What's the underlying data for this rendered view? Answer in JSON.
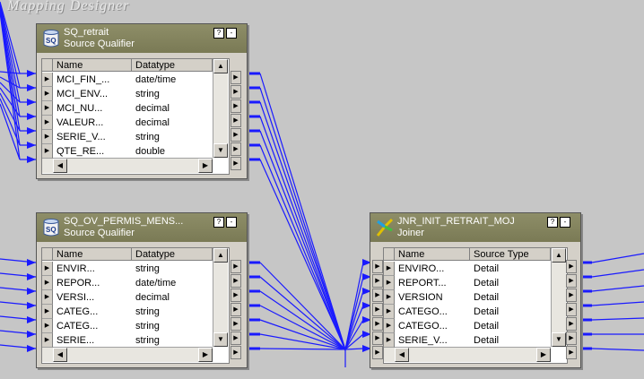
{
  "workspace": {
    "title": "Mapping Designer"
  },
  "colors": {
    "wire": "#1a1aff",
    "header": "#8a8a62"
  },
  "sq_retrait": {
    "name": "SQ_retrait",
    "type": "Source Qualifier",
    "icon": "source-qualifier-icon",
    "help_label": "?",
    "min_label": "-",
    "col1": "Name",
    "col2": "Datatype",
    "rows": [
      {
        "name": "MCI_FIN_...",
        "type": "date/time"
      },
      {
        "name": "MCI_ENV...",
        "type": "string"
      },
      {
        "name": "MCI_NU...",
        "type": "decimal"
      },
      {
        "name": "VALEUR...",
        "type": "decimal"
      },
      {
        "name": "SERIE_V...",
        "type": "string"
      },
      {
        "name": "QTE_RE...",
        "type": "double"
      }
    ]
  },
  "sq_ov": {
    "name": "SQ_OV_PERMIS_MENS...",
    "type": "Source Qualifier",
    "icon": "source-qualifier-icon",
    "help_label": "?",
    "min_label": "-",
    "col1": "Name",
    "col2": "Datatype",
    "rows": [
      {
        "name": "ENVIR...",
        "type": "string"
      },
      {
        "name": "REPOR...",
        "type": "date/time"
      },
      {
        "name": "VERSI...",
        "type": "decimal"
      },
      {
        "name": "CATEG...",
        "type": "string"
      },
      {
        "name": "CATEG...",
        "type": "string"
      },
      {
        "name": "SERIE...",
        "type": "string"
      }
    ]
  },
  "joiner": {
    "name": "JNR_INIT_RETRAIT_MOJ",
    "type": "Joiner",
    "icon": "joiner-icon",
    "help_label": "?",
    "min_label": "-",
    "col1": "Name",
    "col2": "Source Type",
    "rows": [
      {
        "name": "ENVIRO...",
        "type": "Detail"
      },
      {
        "name": "REPORT...",
        "type": "Detail"
      },
      {
        "name": "VERSION",
        "type": "Detail"
      },
      {
        "name": "CATEGO...",
        "type": "Detail"
      },
      {
        "name": "CATEGO...",
        "type": "Detail"
      },
      {
        "name": "SERIE_V...",
        "type": "Detail"
      }
    ]
  }
}
